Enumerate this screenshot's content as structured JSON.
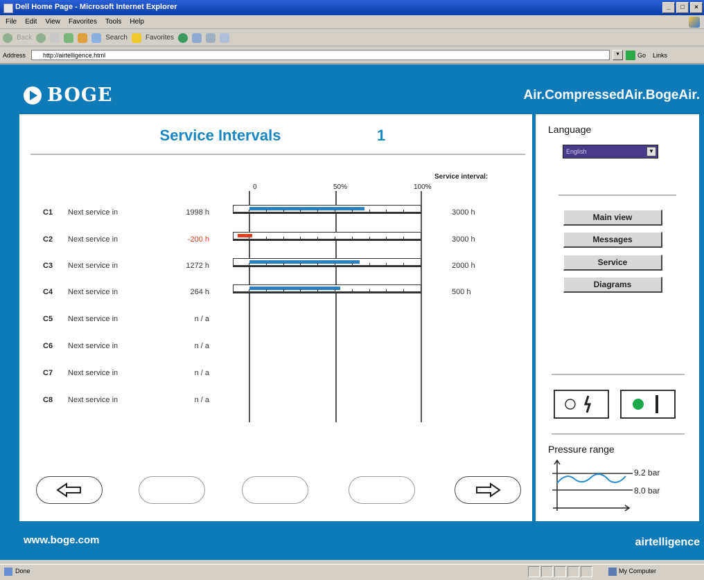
{
  "window": {
    "title": "Dell Home Page - Microsoft Internet Explorer",
    "buttons": [
      "_",
      "□",
      "×"
    ]
  },
  "menu": [
    "File",
    "Edit",
    "View",
    "Favorites",
    "Tools",
    "Help"
  ],
  "toolbar": {
    "back": "Back",
    "search": "Search",
    "favorites": "Favorites"
  },
  "address": {
    "label": "Address",
    "value": "http://airtelligence.html",
    "go": "Go",
    "links": "Links"
  },
  "header": {
    "logo": "BOGE",
    "tagline": "Air.CompressedAir.BogeAir."
  },
  "main": {
    "title": "Service Intervals",
    "page_number": "1",
    "interval_header": "Service interval:",
    "scale": [
      "0",
      "50%",
      "100%"
    ],
    "rows": [
      {
        "id": "C1",
        "text": "Next service in",
        "value": "1998 h",
        "interval": "3000 h",
        "remaining_fraction": 0.67
      },
      {
        "id": "C2",
        "text": "Next service in",
        "value": "-200 h",
        "interval": "3000 h",
        "remaining_fraction": -0.07
      },
      {
        "id": "C3",
        "text": "Next service in",
        "value": "1272 h",
        "interval": "2000 h",
        "remaining_fraction": 0.64
      },
      {
        "id": "C4",
        "text": "Next service in",
        "value": "264 h",
        "interval": "500 h",
        "remaining_fraction": 0.53
      },
      {
        "id": "C5",
        "text": "Next service in",
        "value": "n / a",
        "interval": ""
      },
      {
        "id": "C6",
        "text": "Next service in",
        "value": "n / a",
        "interval": ""
      },
      {
        "id": "C7",
        "text": "Next service in",
        "value": "n / a",
        "interval": ""
      },
      {
        "id": "C8",
        "text": "Next service in",
        "value": "n / a",
        "interval": ""
      }
    ]
  },
  "side": {
    "language_label": "Language",
    "language_value": "English",
    "buttons": [
      "Main view",
      "Messages",
      "Service",
      "Diagrams"
    ],
    "pressure_label": "Pressure range",
    "pressure_high": "9.2 bar",
    "pressure_low": "8.0 bar"
  },
  "footer": {
    "url": "www.boge.com",
    "brand": "airtelligence"
  },
  "status": {
    "text": "Done",
    "zone": "My Computer"
  },
  "colors": {
    "page_blue": "#0f7ab8",
    "title_blue": "#1a86c0",
    "bar_fill": "#2a7fbf",
    "negative": "#e04020",
    "status_on": "#1aa84a"
  }
}
